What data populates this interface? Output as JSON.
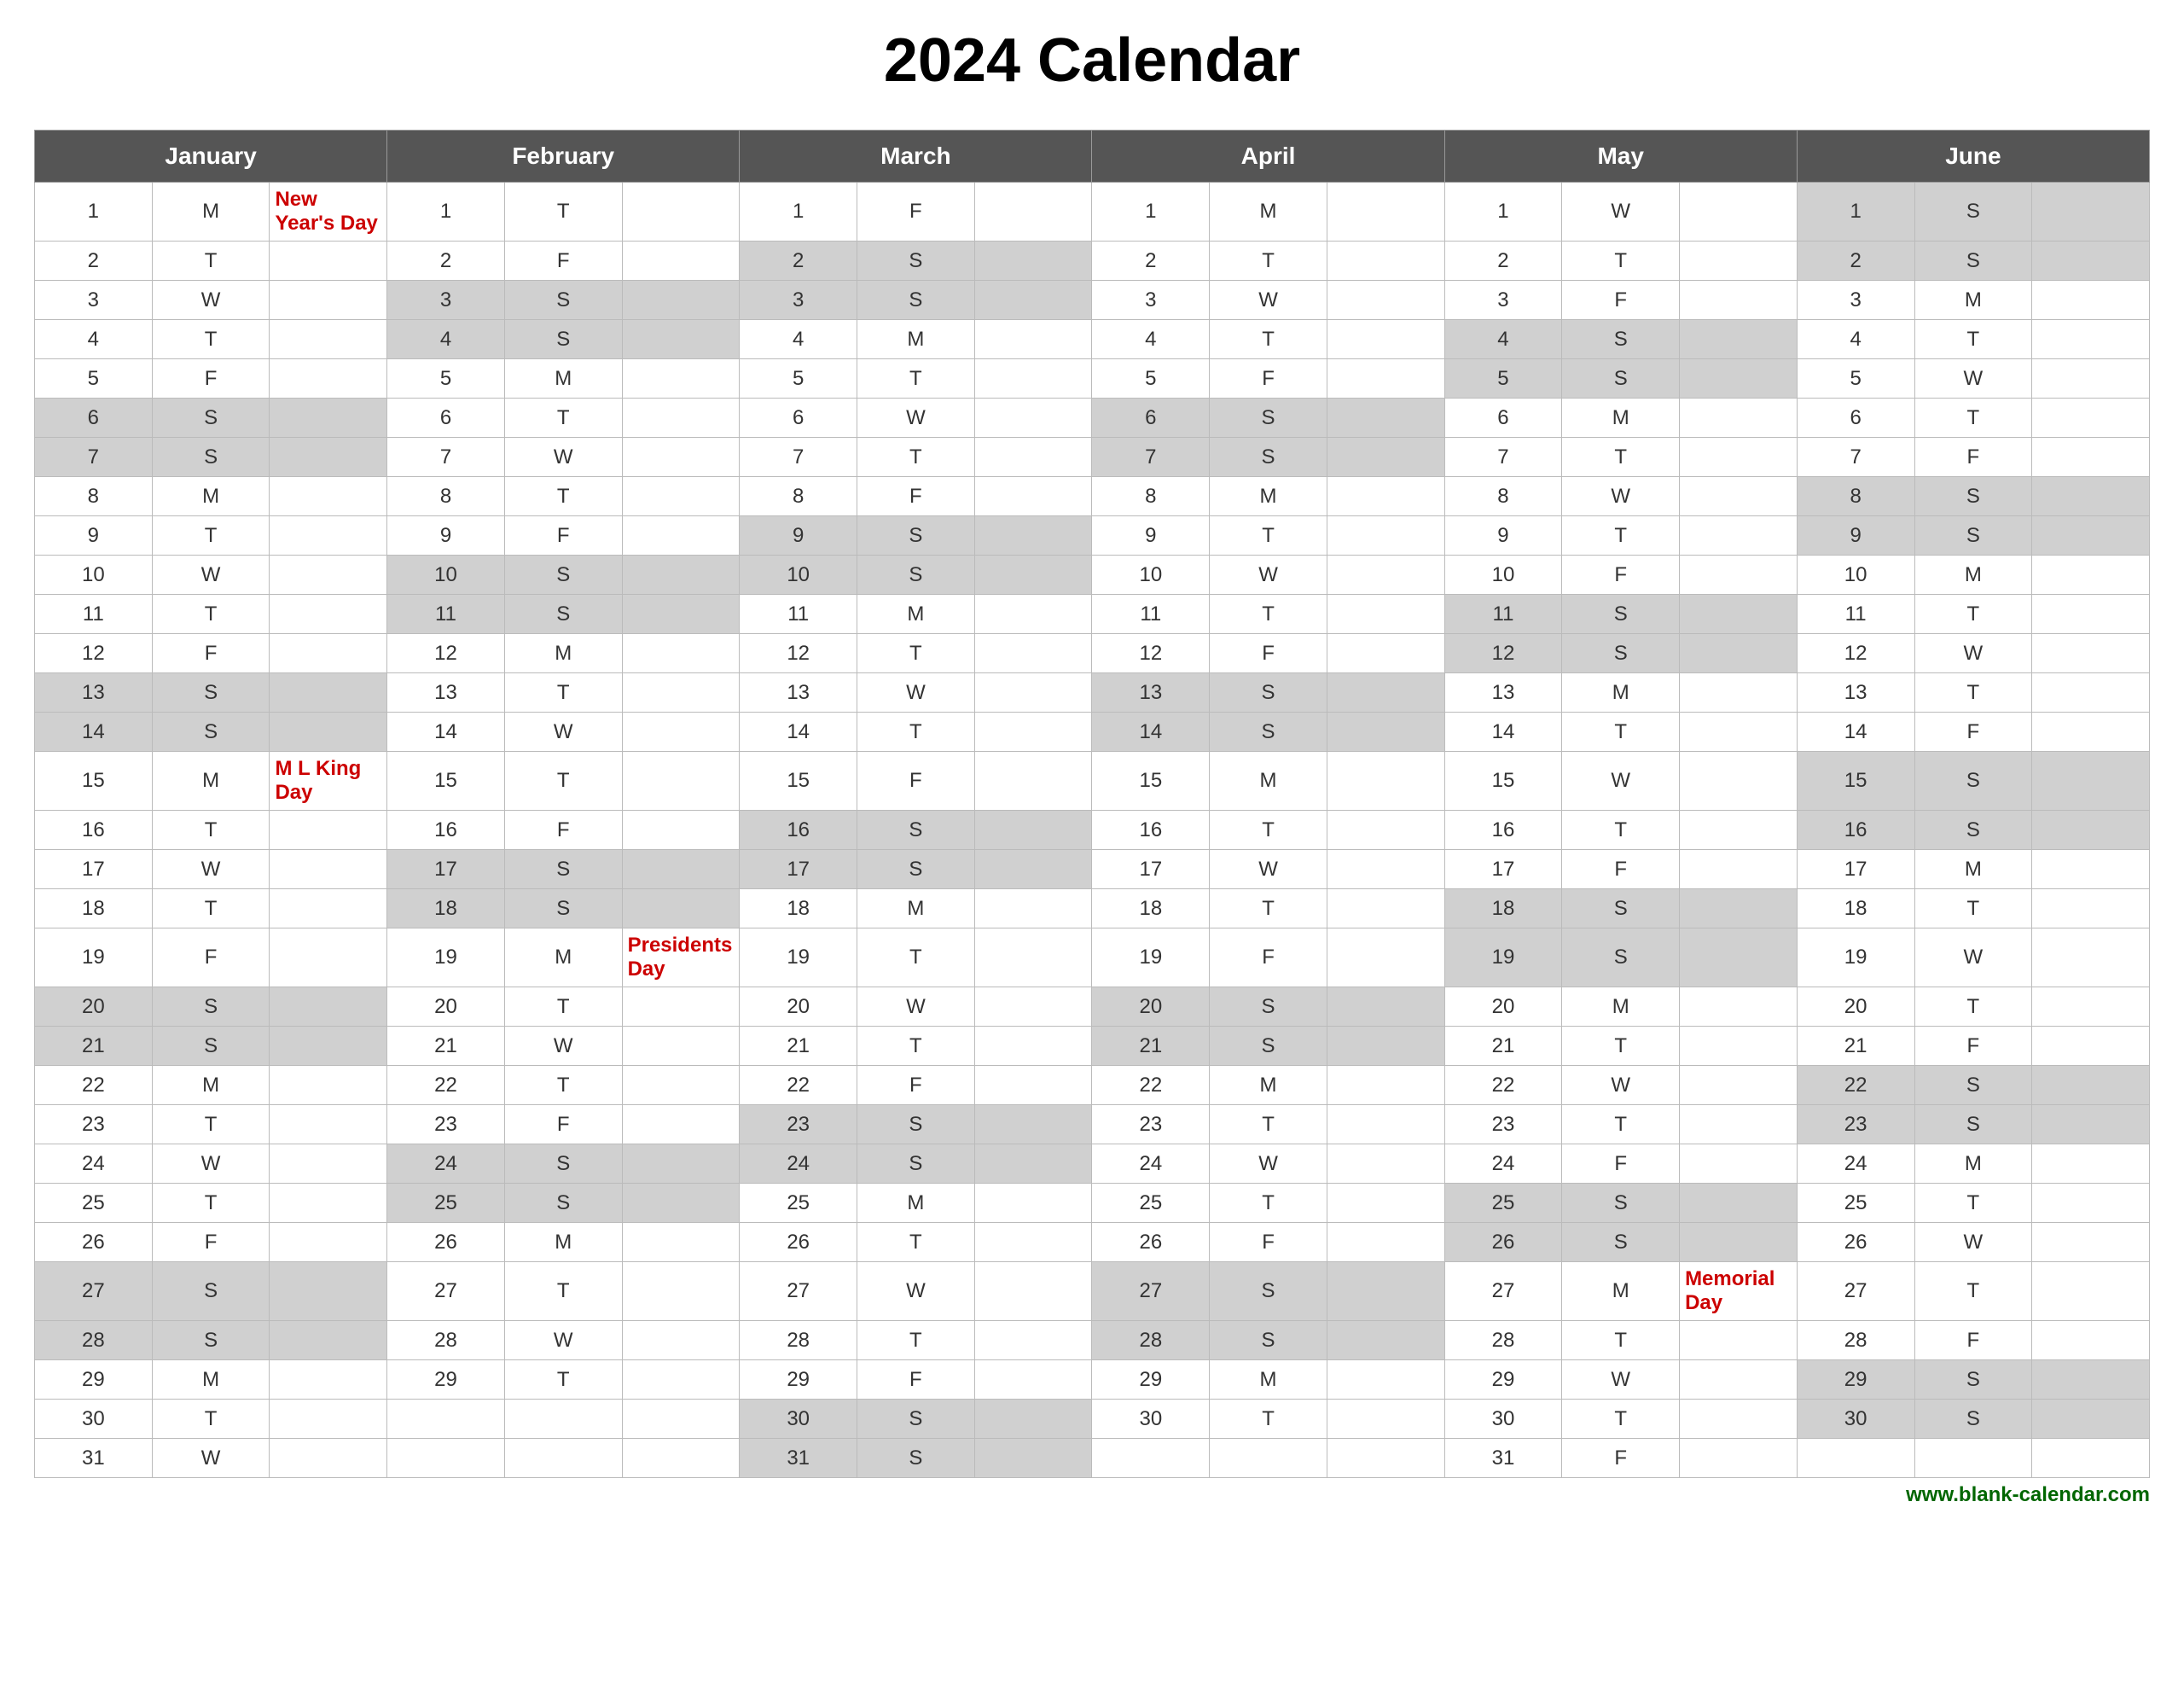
{
  "title": "2024 Calendar",
  "months": [
    "January",
    "February",
    "March",
    "April",
    "May",
    "June"
  ],
  "footer": "www.blank-calendar.com",
  "days": {
    "jan": [
      {
        "d": 1,
        "w": "M",
        "event": "New Year's Day",
        "holiday": true
      },
      {
        "d": 2,
        "w": "T",
        "event": "",
        "holiday": false
      },
      {
        "d": 3,
        "w": "W",
        "event": "",
        "holiday": false
      },
      {
        "d": 4,
        "w": "T",
        "event": "",
        "holiday": false
      },
      {
        "d": 5,
        "w": "F",
        "event": "",
        "holiday": false
      },
      {
        "d": 6,
        "w": "S",
        "event": "",
        "holiday": false
      },
      {
        "d": 7,
        "w": "S",
        "event": "",
        "holiday": false
      },
      {
        "d": 8,
        "w": "M",
        "event": "",
        "holiday": false
      },
      {
        "d": 9,
        "w": "T",
        "event": "",
        "holiday": false
      },
      {
        "d": 10,
        "w": "W",
        "event": "",
        "holiday": false
      },
      {
        "d": 11,
        "w": "T",
        "event": "",
        "holiday": false
      },
      {
        "d": 12,
        "w": "F",
        "event": "",
        "holiday": false
      },
      {
        "d": 13,
        "w": "S",
        "event": "",
        "holiday": false
      },
      {
        "d": 14,
        "w": "S",
        "event": "",
        "holiday": false
      },
      {
        "d": 15,
        "w": "M",
        "event": "M L King Day",
        "holiday": true
      },
      {
        "d": 16,
        "w": "T",
        "event": "",
        "holiday": false
      },
      {
        "d": 17,
        "w": "W",
        "event": "",
        "holiday": false
      },
      {
        "d": 18,
        "w": "T",
        "event": "",
        "holiday": false
      },
      {
        "d": 19,
        "w": "F",
        "event": "",
        "holiday": false
      },
      {
        "d": 20,
        "w": "S",
        "event": "",
        "holiday": false
      },
      {
        "d": 21,
        "w": "S",
        "event": "",
        "holiday": false
      },
      {
        "d": 22,
        "w": "M",
        "event": "",
        "holiday": false
      },
      {
        "d": 23,
        "w": "T",
        "event": "",
        "holiday": false
      },
      {
        "d": 24,
        "w": "W",
        "event": "",
        "holiday": false
      },
      {
        "d": 25,
        "w": "T",
        "event": "",
        "holiday": false
      },
      {
        "d": 26,
        "w": "F",
        "event": "",
        "holiday": false
      },
      {
        "d": 27,
        "w": "S",
        "event": "",
        "holiday": false
      },
      {
        "d": 28,
        "w": "S",
        "event": "",
        "holiday": false
      },
      {
        "d": 29,
        "w": "M",
        "event": "",
        "holiday": false
      },
      {
        "d": 30,
        "w": "T",
        "event": "",
        "holiday": false
      },
      {
        "d": 31,
        "w": "W",
        "event": "",
        "holiday": false
      }
    ],
    "feb": [
      {
        "d": 1,
        "w": "T",
        "event": "",
        "holiday": false
      },
      {
        "d": 2,
        "w": "F",
        "event": "",
        "holiday": false
      },
      {
        "d": 3,
        "w": "S",
        "event": "",
        "holiday": false
      },
      {
        "d": 4,
        "w": "S",
        "event": "",
        "holiday": false
      },
      {
        "d": 5,
        "w": "M",
        "event": "",
        "holiday": false
      },
      {
        "d": 6,
        "w": "T",
        "event": "",
        "holiday": false
      },
      {
        "d": 7,
        "w": "W",
        "event": "",
        "holiday": false
      },
      {
        "d": 8,
        "w": "T",
        "event": "",
        "holiday": false
      },
      {
        "d": 9,
        "w": "F",
        "event": "",
        "holiday": false
      },
      {
        "d": 10,
        "w": "S",
        "event": "",
        "holiday": false
      },
      {
        "d": 11,
        "w": "S",
        "event": "",
        "holiday": false
      },
      {
        "d": 12,
        "w": "M",
        "event": "",
        "holiday": false
      },
      {
        "d": 13,
        "w": "T",
        "event": "",
        "holiday": false
      },
      {
        "d": 14,
        "w": "W",
        "event": "",
        "holiday": false
      },
      {
        "d": 15,
        "w": "T",
        "event": "",
        "holiday": false
      },
      {
        "d": 16,
        "w": "F",
        "event": "",
        "holiday": false
      },
      {
        "d": 17,
        "w": "S",
        "event": "",
        "holiday": false
      },
      {
        "d": 18,
        "w": "S",
        "event": "",
        "holiday": false
      },
      {
        "d": 19,
        "w": "M",
        "event": "Presidents Day",
        "holiday": true
      },
      {
        "d": 20,
        "w": "T",
        "event": "",
        "holiday": false
      },
      {
        "d": 21,
        "w": "W",
        "event": "",
        "holiday": false
      },
      {
        "d": 22,
        "w": "T",
        "event": "",
        "holiday": false
      },
      {
        "d": 23,
        "w": "F",
        "event": "",
        "holiday": false
      },
      {
        "d": 24,
        "w": "S",
        "event": "",
        "holiday": false
      },
      {
        "d": 25,
        "w": "S",
        "event": "",
        "holiday": false
      },
      {
        "d": 26,
        "w": "M",
        "event": "",
        "holiday": false
      },
      {
        "d": 27,
        "w": "T",
        "event": "",
        "holiday": false
      },
      {
        "d": 28,
        "w": "W",
        "event": "",
        "holiday": false
      },
      {
        "d": 29,
        "w": "T",
        "event": "",
        "holiday": false
      }
    ],
    "mar": [
      {
        "d": 1,
        "w": "F",
        "event": "",
        "holiday": false
      },
      {
        "d": 2,
        "w": "S",
        "event": "",
        "holiday": false
      },
      {
        "d": 3,
        "w": "S",
        "event": "",
        "holiday": false
      },
      {
        "d": 4,
        "w": "M",
        "event": "",
        "holiday": false
      },
      {
        "d": 5,
        "w": "T",
        "event": "",
        "holiday": false
      },
      {
        "d": 6,
        "w": "W",
        "event": "",
        "holiday": false
      },
      {
        "d": 7,
        "w": "T",
        "event": "",
        "holiday": false
      },
      {
        "d": 8,
        "w": "F",
        "event": "",
        "holiday": false
      },
      {
        "d": 9,
        "w": "S",
        "event": "",
        "holiday": false
      },
      {
        "d": 10,
        "w": "S",
        "event": "",
        "holiday": false
      },
      {
        "d": 11,
        "w": "M",
        "event": "",
        "holiday": false
      },
      {
        "d": 12,
        "w": "T",
        "event": "",
        "holiday": false
      },
      {
        "d": 13,
        "w": "W",
        "event": "",
        "holiday": false
      },
      {
        "d": 14,
        "w": "T",
        "event": "",
        "holiday": false
      },
      {
        "d": 15,
        "w": "F",
        "event": "",
        "holiday": false
      },
      {
        "d": 16,
        "w": "S",
        "event": "",
        "holiday": false
      },
      {
        "d": 17,
        "w": "S",
        "event": "",
        "holiday": false
      },
      {
        "d": 18,
        "w": "M",
        "event": "",
        "holiday": false
      },
      {
        "d": 19,
        "w": "T",
        "event": "",
        "holiday": false
      },
      {
        "d": 20,
        "w": "W",
        "event": "",
        "holiday": false
      },
      {
        "d": 21,
        "w": "T",
        "event": "",
        "holiday": false
      },
      {
        "d": 22,
        "w": "F",
        "event": "",
        "holiday": false
      },
      {
        "d": 23,
        "w": "S",
        "event": "",
        "holiday": false
      },
      {
        "d": 24,
        "w": "S",
        "event": "",
        "holiday": false
      },
      {
        "d": 25,
        "w": "M",
        "event": "",
        "holiday": false
      },
      {
        "d": 26,
        "w": "T",
        "event": "",
        "holiday": false
      },
      {
        "d": 27,
        "w": "W",
        "event": "",
        "holiday": false
      },
      {
        "d": 28,
        "w": "T",
        "event": "",
        "holiday": false
      },
      {
        "d": 29,
        "w": "F",
        "event": "",
        "holiday": false
      },
      {
        "d": 30,
        "w": "S",
        "event": "",
        "holiday": false
      },
      {
        "d": 31,
        "w": "S",
        "event": "",
        "holiday": false
      }
    ],
    "apr": [
      {
        "d": 1,
        "w": "M",
        "event": "",
        "holiday": false
      },
      {
        "d": 2,
        "w": "T",
        "event": "",
        "holiday": false
      },
      {
        "d": 3,
        "w": "W",
        "event": "",
        "holiday": false
      },
      {
        "d": 4,
        "w": "T",
        "event": "",
        "holiday": false
      },
      {
        "d": 5,
        "w": "F",
        "event": "",
        "holiday": false
      },
      {
        "d": 6,
        "w": "S",
        "event": "",
        "holiday": false
      },
      {
        "d": 7,
        "w": "S",
        "event": "",
        "holiday": false
      },
      {
        "d": 8,
        "w": "M",
        "event": "",
        "holiday": false
      },
      {
        "d": 9,
        "w": "T",
        "event": "",
        "holiday": false
      },
      {
        "d": 10,
        "w": "W",
        "event": "",
        "holiday": false
      },
      {
        "d": 11,
        "w": "T",
        "event": "",
        "holiday": false
      },
      {
        "d": 12,
        "w": "F",
        "event": "",
        "holiday": false
      },
      {
        "d": 13,
        "w": "S",
        "event": "",
        "holiday": false
      },
      {
        "d": 14,
        "w": "S",
        "event": "",
        "holiday": false
      },
      {
        "d": 15,
        "w": "M",
        "event": "",
        "holiday": false
      },
      {
        "d": 16,
        "w": "T",
        "event": "",
        "holiday": false
      },
      {
        "d": 17,
        "w": "W",
        "event": "",
        "holiday": false
      },
      {
        "d": 18,
        "w": "T",
        "event": "",
        "holiday": false
      },
      {
        "d": 19,
        "w": "F",
        "event": "",
        "holiday": false
      },
      {
        "d": 20,
        "w": "S",
        "event": "",
        "holiday": false
      },
      {
        "d": 21,
        "w": "S",
        "event": "",
        "holiday": false
      },
      {
        "d": 22,
        "w": "M",
        "event": "",
        "holiday": false
      },
      {
        "d": 23,
        "w": "T",
        "event": "",
        "holiday": false
      },
      {
        "d": 24,
        "w": "W",
        "event": "",
        "holiday": false
      },
      {
        "d": 25,
        "w": "T",
        "event": "",
        "holiday": false
      },
      {
        "d": 26,
        "w": "F",
        "event": "",
        "holiday": false
      },
      {
        "d": 27,
        "w": "S",
        "event": "",
        "holiday": false
      },
      {
        "d": 28,
        "w": "S",
        "event": "",
        "holiday": false
      },
      {
        "d": 29,
        "w": "M",
        "event": "",
        "holiday": false
      },
      {
        "d": 30,
        "w": "T",
        "event": "",
        "holiday": false
      }
    ],
    "may": [
      {
        "d": 1,
        "w": "W",
        "event": "",
        "holiday": false
      },
      {
        "d": 2,
        "w": "T",
        "event": "",
        "holiday": false
      },
      {
        "d": 3,
        "w": "F",
        "event": "",
        "holiday": false
      },
      {
        "d": 4,
        "w": "S",
        "event": "",
        "holiday": false
      },
      {
        "d": 5,
        "w": "S",
        "event": "",
        "holiday": false
      },
      {
        "d": 6,
        "w": "M",
        "event": "",
        "holiday": false
      },
      {
        "d": 7,
        "w": "T",
        "event": "",
        "holiday": false
      },
      {
        "d": 8,
        "w": "W",
        "event": "",
        "holiday": false
      },
      {
        "d": 9,
        "w": "T",
        "event": "",
        "holiday": false
      },
      {
        "d": 10,
        "w": "F",
        "event": "",
        "holiday": false
      },
      {
        "d": 11,
        "w": "S",
        "event": "",
        "holiday": false
      },
      {
        "d": 12,
        "w": "S",
        "event": "",
        "holiday": false
      },
      {
        "d": 13,
        "w": "M",
        "event": "",
        "holiday": false
      },
      {
        "d": 14,
        "w": "T",
        "event": "",
        "holiday": false
      },
      {
        "d": 15,
        "w": "W",
        "event": "",
        "holiday": false
      },
      {
        "d": 16,
        "w": "T",
        "event": "",
        "holiday": false
      },
      {
        "d": 17,
        "w": "F",
        "event": "",
        "holiday": false
      },
      {
        "d": 18,
        "w": "S",
        "event": "",
        "holiday": false
      },
      {
        "d": 19,
        "w": "S",
        "event": "",
        "holiday": false
      },
      {
        "d": 20,
        "w": "M",
        "event": "",
        "holiday": false
      },
      {
        "d": 21,
        "w": "T",
        "event": "",
        "holiday": false
      },
      {
        "d": 22,
        "w": "W",
        "event": "",
        "holiday": false
      },
      {
        "d": 23,
        "w": "T",
        "event": "",
        "holiday": false
      },
      {
        "d": 24,
        "w": "F",
        "event": "",
        "holiday": false
      },
      {
        "d": 25,
        "w": "S",
        "event": "",
        "holiday": false
      },
      {
        "d": 26,
        "w": "S",
        "event": "",
        "holiday": false
      },
      {
        "d": 27,
        "w": "M",
        "event": "Memorial Day",
        "holiday": true
      },
      {
        "d": 28,
        "w": "T",
        "event": "",
        "holiday": false
      },
      {
        "d": 29,
        "w": "W",
        "event": "",
        "holiday": false
      },
      {
        "d": 30,
        "w": "T",
        "event": "",
        "holiday": false
      },
      {
        "d": 31,
        "w": "F",
        "event": "",
        "holiday": false
      }
    ],
    "jun": [
      {
        "d": 1,
        "w": "S",
        "event": "",
        "holiday": false
      },
      {
        "d": 2,
        "w": "S",
        "event": "",
        "holiday": false
      },
      {
        "d": 3,
        "w": "M",
        "event": "",
        "holiday": false
      },
      {
        "d": 4,
        "w": "T",
        "event": "",
        "holiday": false
      },
      {
        "d": 5,
        "w": "W",
        "event": "",
        "holiday": false
      },
      {
        "d": 6,
        "w": "T",
        "event": "",
        "holiday": false
      },
      {
        "d": 7,
        "w": "F",
        "event": "",
        "holiday": false
      },
      {
        "d": 8,
        "w": "S",
        "event": "",
        "holiday": false
      },
      {
        "d": 9,
        "w": "S",
        "event": "",
        "holiday": false
      },
      {
        "d": 10,
        "w": "M",
        "event": "",
        "holiday": false
      },
      {
        "d": 11,
        "w": "T",
        "event": "",
        "holiday": false
      },
      {
        "d": 12,
        "w": "W",
        "event": "",
        "holiday": false
      },
      {
        "d": 13,
        "w": "T",
        "event": "",
        "holiday": false
      },
      {
        "d": 14,
        "w": "F",
        "event": "",
        "holiday": false
      },
      {
        "d": 15,
        "w": "S",
        "event": "",
        "holiday": false
      },
      {
        "d": 16,
        "w": "S",
        "event": "",
        "holiday": false
      },
      {
        "d": 17,
        "w": "M",
        "event": "",
        "holiday": false
      },
      {
        "d": 18,
        "w": "T",
        "event": "",
        "holiday": false
      },
      {
        "d": 19,
        "w": "W",
        "event": "",
        "holiday": false
      },
      {
        "d": 20,
        "w": "T",
        "event": "",
        "holiday": false
      },
      {
        "d": 21,
        "w": "F",
        "event": "",
        "holiday": false
      },
      {
        "d": 22,
        "w": "S",
        "event": "",
        "holiday": false
      },
      {
        "d": 23,
        "w": "S",
        "event": "",
        "holiday": false
      },
      {
        "d": 24,
        "w": "M",
        "event": "",
        "holiday": false
      },
      {
        "d": 25,
        "w": "T",
        "event": "",
        "holiday": false
      },
      {
        "d": 26,
        "w": "W",
        "event": "",
        "holiday": false
      },
      {
        "d": 27,
        "w": "T",
        "event": "",
        "holiday": false
      },
      {
        "d": 28,
        "w": "F",
        "event": "",
        "holiday": false
      },
      {
        "d": 29,
        "w": "S",
        "event": "",
        "holiday": false
      },
      {
        "d": 30,
        "w": "S",
        "event": "",
        "holiday": false
      }
    ]
  }
}
